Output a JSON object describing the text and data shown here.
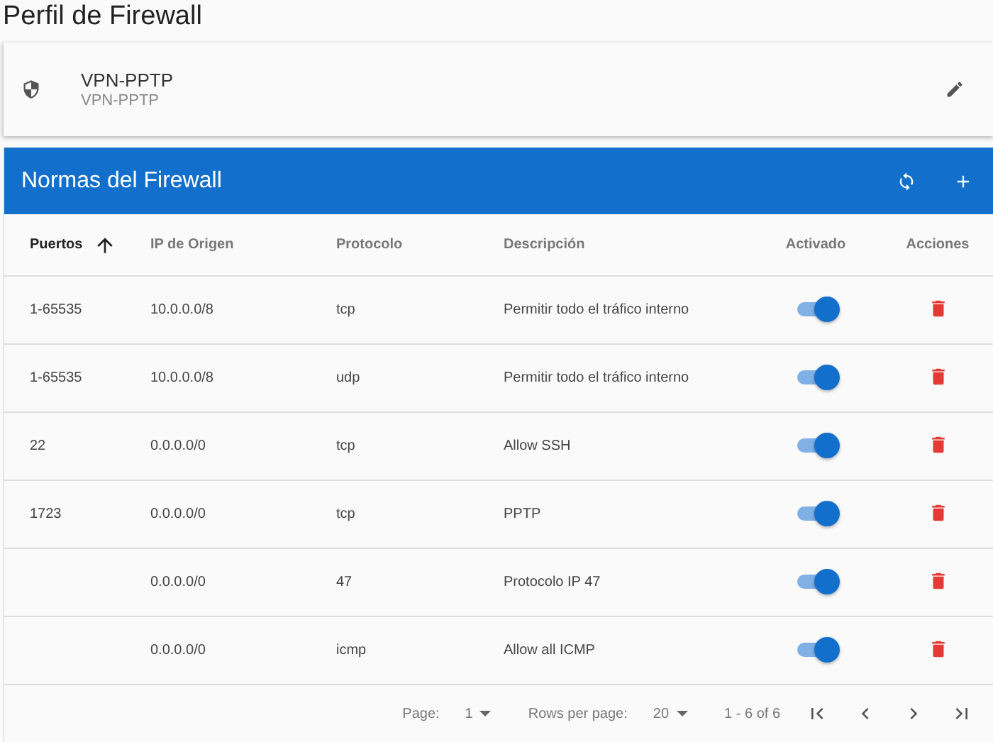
{
  "page_title": "Perfil de Firewall",
  "profile": {
    "name": "VPN-PPTP",
    "subtitle": "VPN-PPTP"
  },
  "toolbar": {
    "title": "Normas del Firewall"
  },
  "table": {
    "columns": [
      {
        "label": "Puertos",
        "sorted": true
      },
      {
        "label": "IP de Origen",
        "sorted": false
      },
      {
        "label": "Protocolo",
        "sorted": false
      },
      {
        "label": "Descripción",
        "sorted": false
      },
      {
        "label": "Activado",
        "sorted": false
      },
      {
        "label": "Acciones",
        "sorted": false
      }
    ],
    "rows": [
      {
        "ports": "1-65535",
        "source_ip": "10.0.0.0/8",
        "protocol": "tcp",
        "description": "Permitir todo el tráfico interno",
        "enabled": true
      },
      {
        "ports": "1-65535",
        "source_ip": "10.0.0.0/8",
        "protocol": "udp",
        "description": "Permitir todo el tráfico interno",
        "enabled": true
      },
      {
        "ports": "22",
        "source_ip": "0.0.0.0/0",
        "protocol": "tcp",
        "description": "Allow SSH",
        "enabled": true
      },
      {
        "ports": "1723",
        "source_ip": "0.0.0.0/0",
        "protocol": "tcp",
        "description": "PPTP",
        "enabled": true
      },
      {
        "ports": "",
        "source_ip": "0.0.0.0/0",
        "protocol": "47",
        "description": "Protocolo IP 47",
        "enabled": true
      },
      {
        "ports": "",
        "source_ip": "0.0.0.0/0",
        "protocol": "icmp",
        "description": "Allow all ICMP",
        "enabled": true
      }
    ]
  },
  "pagination": {
    "page_label": "Page:",
    "page": "1",
    "rows_label": "Rows per page:",
    "rows_per_page": "20",
    "range": "1 - 6 of 6"
  }
}
